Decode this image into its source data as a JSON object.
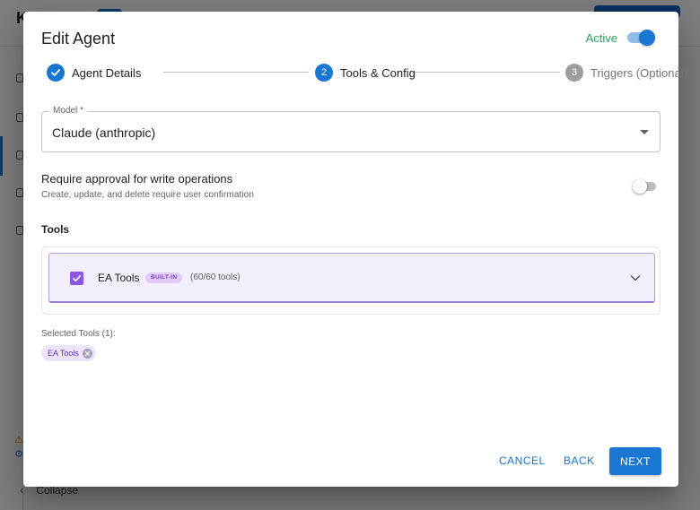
{
  "background": {
    "logo": "K",
    "collapse_label": "Collapse"
  },
  "dialog": {
    "title": "Edit Agent",
    "active_label": "Active",
    "active_on": true
  },
  "stepper": {
    "steps": [
      {
        "number": "1",
        "label": "Agent Details",
        "state": "done"
      },
      {
        "number": "2",
        "label": "Tools & Config",
        "state": "current"
      },
      {
        "number": "3",
        "label": "Triggers (Optional)",
        "state": "todo"
      }
    ]
  },
  "model": {
    "label": "Model *",
    "value": "Claude (anthropic)"
  },
  "approval": {
    "title": "Require approval for write operations",
    "description": "Create, update, and delete require user confirmation",
    "enabled": false
  },
  "tools": {
    "heading": "Tools",
    "items": [
      {
        "name": "EA Tools",
        "badge": "BUILT-IN",
        "count": "(60/60 tools)",
        "checked": true
      }
    ],
    "selected_label": "Selected Tools (1):",
    "selected_chips": [
      "EA Tools"
    ]
  },
  "actions": {
    "cancel": "CANCEL",
    "back": "BACK",
    "next": "NEXT"
  },
  "colors": {
    "primary": "#1976d2",
    "active_green": "#2e9d5a",
    "tool_accent": "#8c54e0"
  }
}
